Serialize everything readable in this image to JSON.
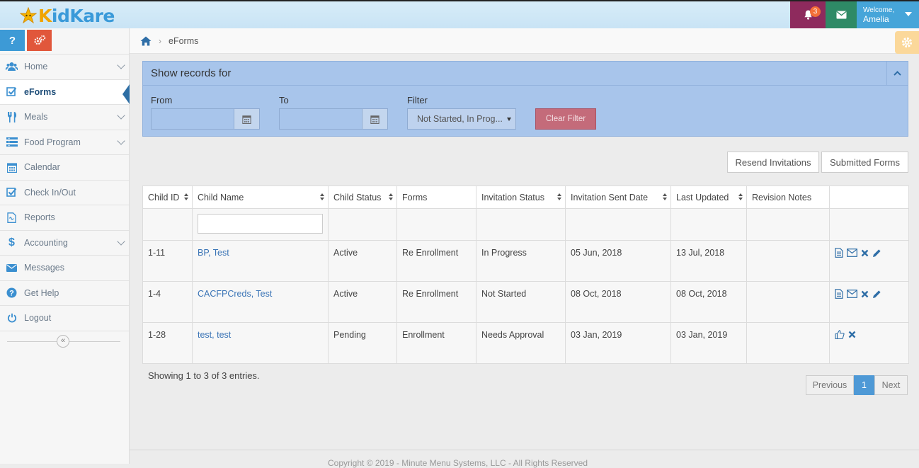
{
  "app": {
    "logo_text_k": "K",
    "logo_text_rest": "idKare",
    "brand_color": "#3a9ad9"
  },
  "topbar": {
    "notification_count": "3",
    "welcome_label": "Welcome,",
    "user_name": "Amelia"
  },
  "sidebar": {
    "help_label": "?",
    "items": [
      {
        "label": "Home",
        "icon": "users-icon",
        "has_chevron": true
      },
      {
        "label": "eForms",
        "icon": "checkbox-icon",
        "active": true
      },
      {
        "label": "Meals",
        "icon": "utensils-icon",
        "has_chevron": true
      },
      {
        "label": "Food Program",
        "icon": "list-icon",
        "has_chevron": true
      },
      {
        "label": "Calendar",
        "icon": "calendar-icon"
      },
      {
        "label": "Check In/Out",
        "icon": "checkbox-icon"
      },
      {
        "label": "Reports",
        "icon": "document-icon"
      },
      {
        "label": "Accounting",
        "icon": "dollar-icon",
        "has_chevron": true
      },
      {
        "label": "Messages",
        "icon": "envelope-icon"
      },
      {
        "label": "Get Help",
        "icon": "question-circle-icon"
      },
      {
        "label": "Logout",
        "icon": "power-icon"
      }
    ],
    "collapse_label": "«"
  },
  "breadcrumb": {
    "current": "eForms"
  },
  "filter": {
    "title": "Show records for",
    "from_label": "From",
    "to_label": "To",
    "filter_label": "Filter",
    "filter_value": "Not Started, In Prog...",
    "from_value": "",
    "to_value": "",
    "clear_label": "Clear Filter"
  },
  "actions": {
    "resend_label": "Resend Invitations",
    "submitted_label": "Submitted Forms"
  },
  "table": {
    "columns": [
      "Child ID",
      "Child Name",
      "Child Status",
      "Forms",
      "Invitation Status",
      "Invitation Sent Date",
      "Last Updated",
      "Revision Notes",
      ""
    ],
    "search_value": "",
    "rows": [
      {
        "id": "1-11",
        "name": "BP, Test",
        "status": "Active",
        "forms": "Re Enrollment",
        "invitation_status": "In Progress",
        "sent": "05 Jun, 2018",
        "updated": "13 Jul, 2018",
        "notes": ""
      },
      {
        "id": "1-4",
        "name": "CACFPCreds, Test",
        "status": "Active",
        "forms": "Re Enrollment",
        "invitation_status": "Not Started",
        "sent": "08 Oct, 2018",
        "updated": "08 Oct, 2018",
        "notes": ""
      },
      {
        "id": "1-28",
        "name": "test, test",
        "status": "Pending",
        "forms": "Enrollment",
        "invitation_status": "Needs Approval",
        "sent": "03 Jan, 2019",
        "updated": "03 Jan, 2019",
        "notes": ""
      }
    ]
  },
  "summary": {
    "showing": "Showing 1 to 3 of 3 entries."
  },
  "pager": {
    "previous": "Previous",
    "current": "1",
    "next": "Next"
  },
  "footer": {
    "text": "Copyright © 2019 - Minute Menu Systems, LLC - All Rights Reserved"
  }
}
